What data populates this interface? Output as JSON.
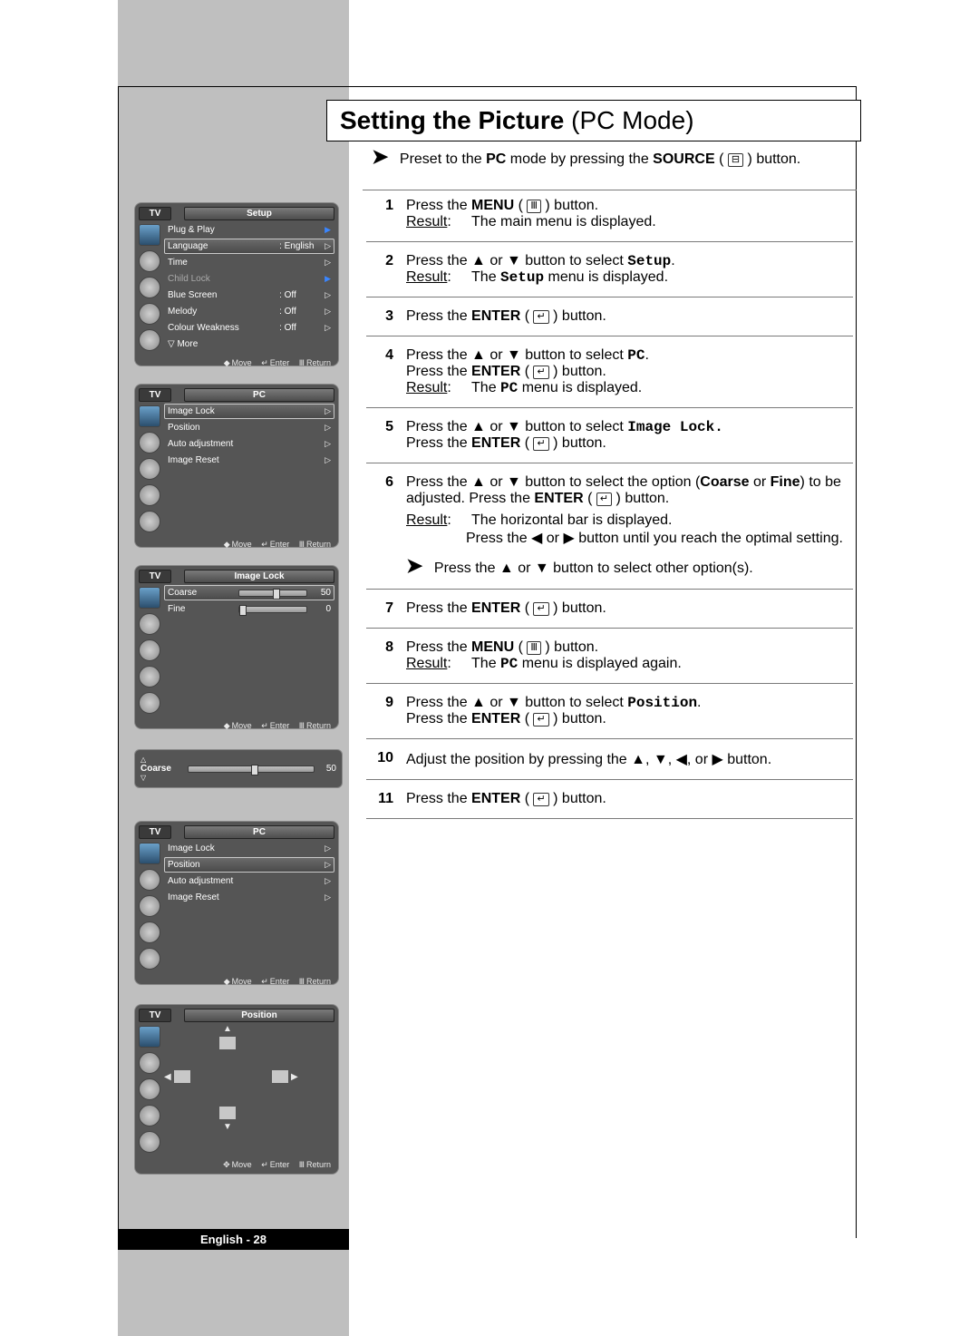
{
  "title": {
    "main": "Setting the Picture",
    "sub": " (PC Mode)"
  },
  "intro": {
    "pre": "Preset to the ",
    "pc": "PC",
    "mid": " mode by pressing the ",
    "source": "SOURCE",
    "post": " button."
  },
  "steps": {
    "s1": {
      "num": "1",
      "a1": "Press the ",
      "a2": "MENU",
      "a3": " button.",
      "r_label": "Result",
      "r_text": "The main menu is displayed."
    },
    "s2": {
      "num": "2",
      "a1": "Press the ▲ or ▼ button to select ",
      "a2": "Setup",
      "a3": ".",
      "r_label": "Result",
      "r_text1": "The ",
      "r_text2": "Setup",
      "r_text3": " menu is displayed."
    },
    "s3": {
      "num": "3",
      "a1": "Press the ",
      "a2": "ENTER",
      "a3": " button."
    },
    "s4": {
      "num": "4",
      "a1": "Press the ▲ or ▼ button to select ",
      "a2": "PC",
      "a3": ".",
      "b1": "Press the ",
      "b2": "ENTER",
      "b3": " button.",
      "r_label": "Result",
      "r_text1": "The ",
      "r_text2": "PC",
      "r_text3": "  menu is displayed."
    },
    "s5": {
      "num": "5",
      "a1": "Press the ▲ or ▼ button to select ",
      "a2": "Image Lock.",
      "b1": "Press the ",
      "b2": "ENTER",
      "b3": " button."
    },
    "s6": {
      "num": "6",
      "a1": "Press the ▲ or ▼ button to select the option (",
      "a2": "Coarse",
      "a3": " or ",
      "a4": "Fine",
      "a5": ") to be adjusted. Press the ",
      "a6": "ENTER",
      "a7": " button.",
      "r_label": "Result",
      "r_text": "The horizontal bar is displayed.",
      "r_text2": "Press the ◀ or ▶ button until you reach the optimal setting.",
      "note": "Press the ▲ or ▼ button to select other option(s)."
    },
    "s7": {
      "num": "7",
      "a1": "Press the ",
      "a2": "ENTER",
      "a3": " button."
    },
    "s8": {
      "num": "8",
      "a1": "Press the ",
      "a2": "MENU",
      "a3": " button.",
      "r_label": "Result",
      "r_text1": "The ",
      "r_text2": "PC",
      "r_text3": "  menu is displayed again."
    },
    "s9": {
      "num": "9",
      "a1": "Press the ▲ or ▼ button to select ",
      "a2": "Position",
      "a3": ".",
      "b1": "Press the ",
      "b2": "ENTER",
      "b3": " button."
    },
    "s10": {
      "num": "10",
      "a1": "Adjust the position by pressing the ▲, ▼, ◀, or ▶ button."
    },
    "s11": {
      "num": "11",
      "a1": "Press the ",
      "a2": "ENTER",
      "a3": " button."
    }
  },
  "osd_common": {
    "tv": "TV",
    "move": "Move",
    "enter": "Enter",
    "return": "Return"
  },
  "osd_setup": {
    "title": "Setup",
    "items": [
      {
        "lab": "Plug & Play",
        "val": "",
        "chev": "blue",
        "dim": false
      },
      {
        "lab": "Language",
        "val": ": English",
        "chev": "white",
        "sel": true
      },
      {
        "lab": "Time",
        "val": "",
        "chev": "white"
      },
      {
        "lab": "Child Lock",
        "val": "",
        "chev": "blue",
        "dim": true
      },
      {
        "lab": "Blue Screen",
        "val": ": Off",
        "chev": "white"
      },
      {
        "lab": "Melody",
        "val": ": Off",
        "chev": "white"
      },
      {
        "lab": "Colour Weakness",
        "val": ": Off",
        "chev": "white"
      },
      {
        "lab": "▽ More",
        "val": "",
        "chev": ""
      }
    ]
  },
  "osd_pc1": {
    "title": "PC",
    "items": [
      {
        "lab": "Image Lock",
        "chev": "white",
        "sel": true
      },
      {
        "lab": "Position",
        "chev": "white"
      },
      {
        "lab": "Auto adjustment",
        "chev": "white"
      },
      {
        "lab": "Image Reset",
        "chev": "white"
      }
    ]
  },
  "osd_imagelock": {
    "title": "Image Lock",
    "items": [
      {
        "lab": "Coarse",
        "val": "50",
        "pos": 50,
        "sel": true
      },
      {
        "lab": "Fine",
        "val": "0",
        "pos": 0
      }
    ]
  },
  "popup_coarse": {
    "lab": "Coarse",
    "val": "50",
    "pos": 50
  },
  "osd_pc2": {
    "title": "PC",
    "items": [
      {
        "lab": "Image Lock",
        "chev": "white"
      },
      {
        "lab": "Position",
        "chev": "white",
        "sel": true
      },
      {
        "lab": "Auto adjustment",
        "chev": "white"
      },
      {
        "lab": "Image Reset",
        "chev": "white"
      }
    ]
  },
  "osd_position": {
    "title": "Position"
  },
  "page_number": "English - 28"
}
